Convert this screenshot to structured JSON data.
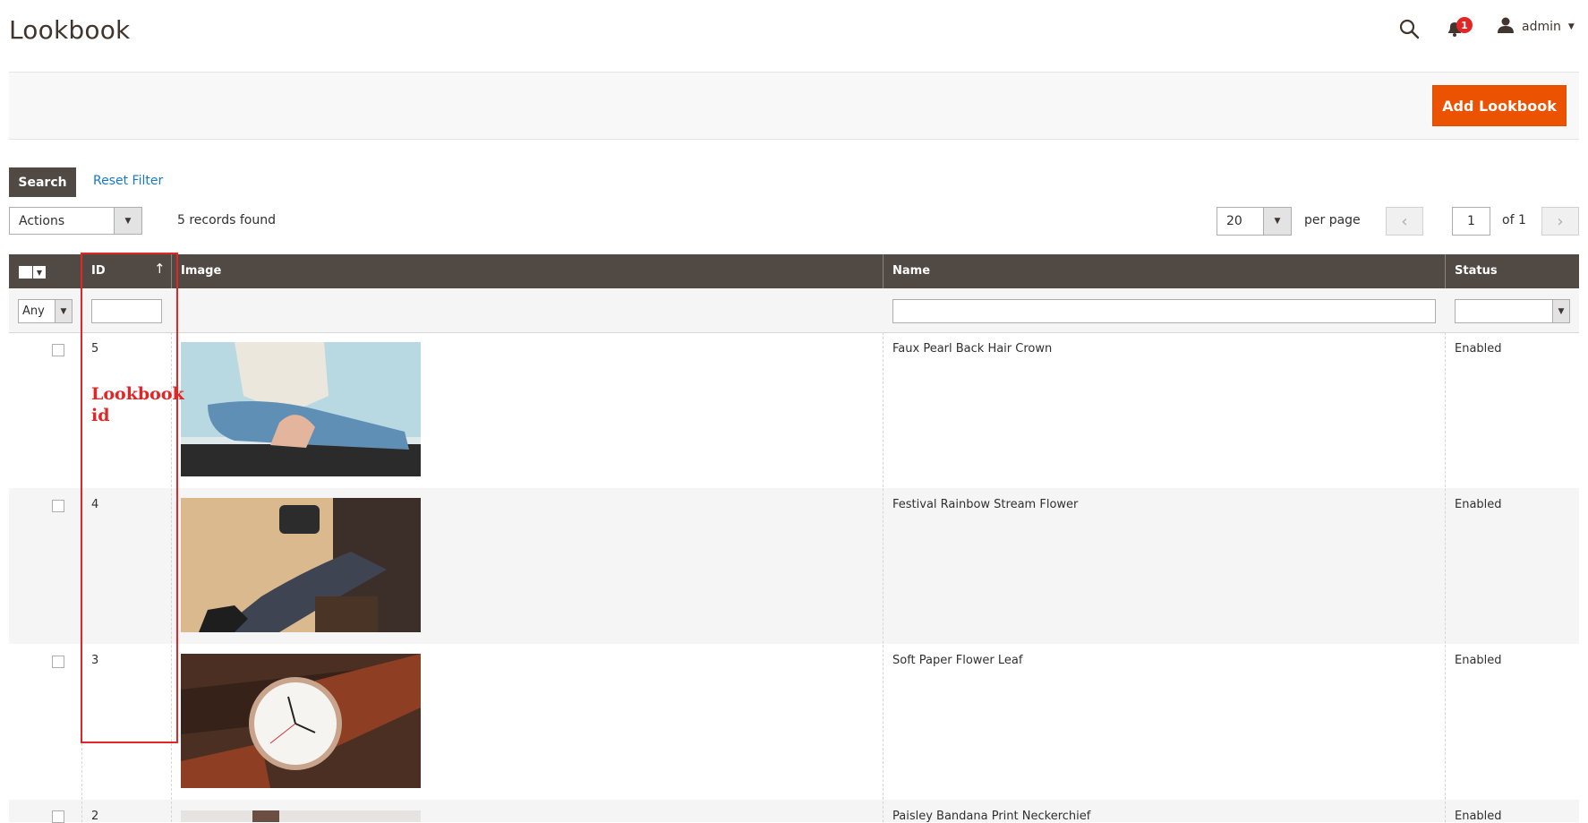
{
  "page": {
    "title": "Lookbook"
  },
  "header": {
    "user": "admin",
    "notification_count": "1"
  },
  "actions": {
    "add_label": "Add Lookbook"
  },
  "filters": {
    "search_label": "Search",
    "reset_label": "Reset Filter"
  },
  "toolbar": {
    "mass_action": "Actions",
    "records_found": "5 records found",
    "per_page_value": "20",
    "per_page_label": "per page",
    "prev_glyph": "‹",
    "next_glyph": "›",
    "current_page": "1",
    "of_pages": "of 1"
  },
  "grid": {
    "columns": {
      "id": "ID",
      "image": "Image",
      "name": "Name",
      "status": "Status"
    },
    "sort_indicator": "↑",
    "massaction_filter": "Any",
    "rows": [
      {
        "id": "5",
        "name": "Faux Pearl Back Hair Crown",
        "status": "Enabled"
      },
      {
        "id": "4",
        "name": "Festival Rainbow Stream Flower",
        "status": "Enabled"
      },
      {
        "id": "3",
        "name": "Soft Paper Flower Leaf",
        "status": "Enabled"
      },
      {
        "id": "2",
        "name": "Paisley Bandana Print Neckerchief",
        "status": "Enabled"
      }
    ]
  },
  "annotation": {
    "line1": "Lookbook",
    "line2": "id"
  },
  "colors": {
    "accent": "#eb5202",
    "grid_header": "#514943",
    "link": "#1979c3",
    "annotation": "#e22626"
  }
}
